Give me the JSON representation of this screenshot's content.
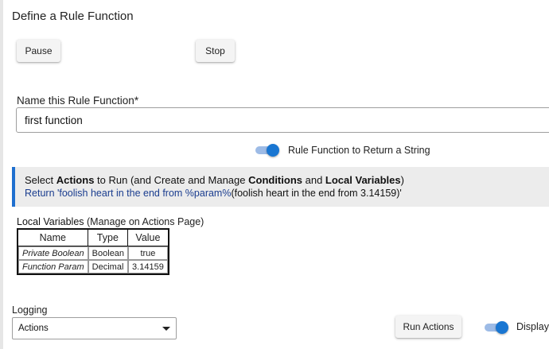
{
  "page": {
    "title": "Define a Rule Function"
  },
  "buttons": {
    "pause": "Pause",
    "stop": "Stop",
    "run_actions": "Run Actions"
  },
  "name_field": {
    "label": "Name this Rule Function*",
    "value": "first function"
  },
  "return_string_toggle": {
    "label": "Rule Function to Return a String",
    "on": true
  },
  "actions_section": {
    "line1_prefix": "Select ",
    "line1_actions": "Actions",
    "line1_middle": " to Run (and Create and Manage ",
    "line1_conditions": "Conditions",
    "line1_and": " and ",
    "line1_local_vars": "Local Variables",
    "line1_suffix": ")",
    "return_text": "Return 'foolish heart in the end from %param%",
    "return_eval": "(foolish heart in the end from 3.14159)'"
  },
  "local_variables": {
    "heading_bold": "Local Variables",
    "heading_rest": " (Manage on Actions Page)",
    "columns": [
      "Name",
      "Type",
      "Value"
    ],
    "rows": [
      {
        "name": "Private Boolean",
        "type": "Boolean",
        "value": "true"
      },
      {
        "name": "Function Param",
        "type": "Decimal",
        "value": "3.14159"
      }
    ]
  },
  "logging": {
    "label": "Logging",
    "selected": "Actions"
  },
  "display_toggle": {
    "label": "Display",
    "on": true
  },
  "colors": {
    "accent": "#1976d2",
    "toggle_track": "#9dbbe6",
    "section_bg": "#ececec",
    "section_border": "#1f6fcf",
    "return_text": "#1a3d8f"
  },
  "icons": {
    "select_arrow": "caret-down-icon"
  }
}
